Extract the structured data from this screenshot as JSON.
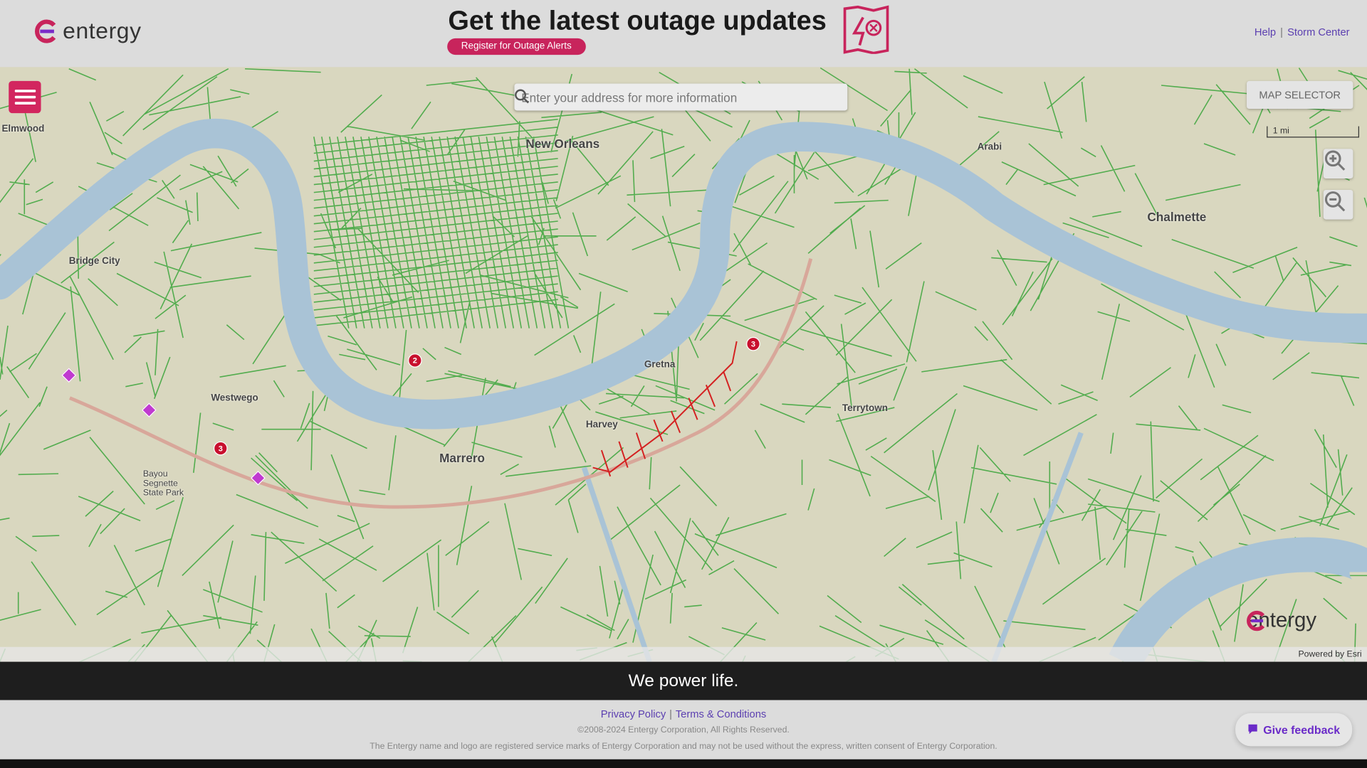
{
  "header": {
    "logo_text": "entergy",
    "banner_title": "Get the latest outage updates",
    "banner_button": "Register for Outage Alerts",
    "links": [
      "Help",
      "Storm Center"
    ]
  },
  "map": {
    "search_placeholder": "Enter your address for more information",
    "map_selector": "MAP SELECTOR",
    "scale_label": "1 mi",
    "watermark_text": "entergy",
    "attribution": "Powered by Esri",
    "place_labels": [
      "New Orleans",
      "Bridge City",
      "Westwego",
      "Marrero",
      "Gretna",
      "Harvey",
      "Terrytown",
      "Chalmette",
      "Arabi",
      "Elmwood",
      "Bayou Segnette State Park"
    ],
    "outage_markers": [
      {
        "count": "2"
      },
      {
        "count": "3"
      },
      {
        "count": "3"
      }
    ],
    "colors": {
      "power_lines": "#3aa53a",
      "outage_lines": "#d42020",
      "water": "#a9c3d6",
      "land": "#d9d7bf",
      "marker": "#c8102e",
      "brand": "#d2265f"
    }
  },
  "tagline": "We power life.",
  "footer": {
    "links": [
      "Privacy Policy",
      "Terms & Conditions"
    ],
    "copyright": "©2008-2024 Entergy Corporation, All Rights Reserved.",
    "legal": "The Entergy name and logo are registered service marks of Entergy Corporation and may not be used without the express, written consent of Entergy Corporation.",
    "feedback": "Give feedback"
  }
}
